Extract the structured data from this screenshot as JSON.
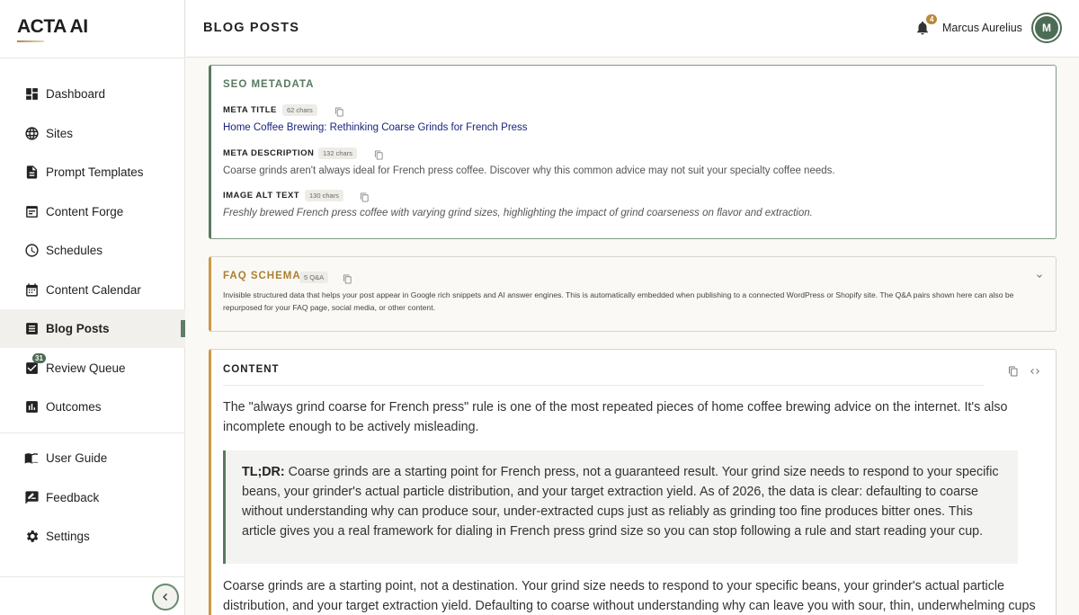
{
  "app": {
    "logo": "ACTA AI"
  },
  "sidebar": {
    "items": [
      {
        "label": "Dashboard",
        "icon": "dashboard-icon"
      },
      {
        "label": "Sites",
        "icon": "globe-icon"
      },
      {
        "label": "Prompt Templates",
        "icon": "document-icon"
      },
      {
        "label": "Content Forge",
        "icon": "forge-icon"
      },
      {
        "label": "Schedules",
        "icon": "clock-icon"
      },
      {
        "label": "Content Calendar",
        "icon": "calendar-icon"
      },
      {
        "label": "Blog Posts",
        "icon": "article-icon",
        "active": true
      },
      {
        "label": "Review Queue",
        "icon": "checkbox-icon",
        "badge": "31"
      },
      {
        "label": "Outcomes",
        "icon": "chart-icon"
      }
    ],
    "footer_items": [
      {
        "label": "User Guide",
        "icon": "book-icon"
      },
      {
        "label": "Feedback",
        "icon": "feedback-icon"
      },
      {
        "label": "Settings",
        "icon": "gear-icon"
      }
    ]
  },
  "header": {
    "title": "BLOG POSTS",
    "notification_count": "4",
    "user_name": "Marcus Aurelius",
    "avatar_initial": "M"
  },
  "seo": {
    "heading": "SEO METADATA",
    "meta_title": {
      "label": "META TITLE",
      "chars": "62 chars",
      "value": "Home Coffee Brewing: Rethinking Coarse Grinds for French Press"
    },
    "meta_description": {
      "label": "META DESCRIPTION",
      "chars": "132 chars",
      "value": "Coarse grinds aren't always ideal for French press coffee. Discover why this common advice may not suit your specialty coffee needs."
    },
    "image_alt": {
      "label": "IMAGE ALT TEXT",
      "chars": "130 chars",
      "value": "Freshly brewed French press coffee with varying grind sizes, highlighting the impact of grind coarseness on flavor and extraction."
    }
  },
  "faq": {
    "heading": "FAQ SCHEMA",
    "count": "5 Q&A",
    "description": "Invisible structured data that helps your post appear in Google rich snippets and AI answer engines. This is automatically embedded when publishing to a connected WordPress or Shopify site. The Q&A pairs shown here can also be repurposed for your FAQ page, social media, or other content."
  },
  "content": {
    "heading": "CONTENT",
    "intro": "The \"always grind coarse for French press\" rule is one of the most repeated pieces of home coffee brewing advice on the internet. It's also incomplete enough to be actively misleading.",
    "tldr_label": "TL;DR:",
    "tldr_text": " Coarse grinds are a starting point for French press, not a guaranteed result. Your grind size needs to respond to your specific beans, your grinder's actual particle distribution, and your target extraction yield. As of 2026, the data is clear: defaulting to coarse without understanding why can produce sour, under-extracted cups just as reliably as grinding too fine produces bitter ones. This article gives you a real framework for dialing in French press grind size so you can stop following a rule and start reading your cup.",
    "paragraph": "Coarse grinds are a starting point, not a destination. Your grind size needs to respond to your specific beans, your grinder's actual particle distribution, and your target extraction yield. Defaulting to coarse without understanding why can leave you with sour, thin, underwhelming cups just as easily as"
  },
  "colors": {
    "accent_green": "#587a60",
    "accent_gold": "#c99a4a",
    "link": "#1a237e"
  }
}
